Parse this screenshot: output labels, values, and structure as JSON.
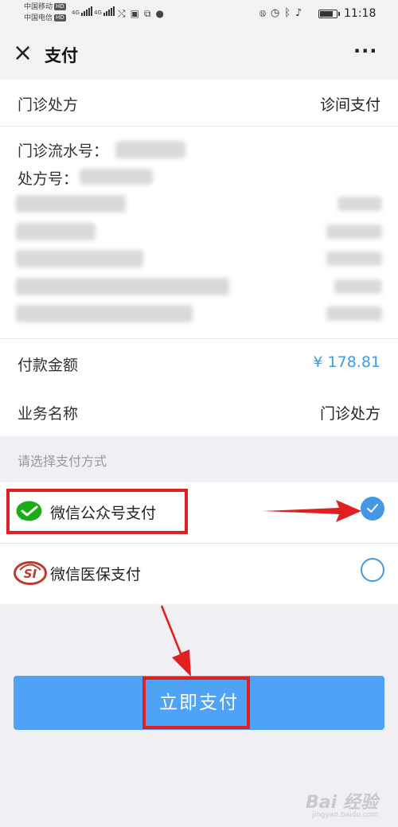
{
  "status_bar": {
    "carrier_1": "中国移动",
    "carrier_2": "中国电信",
    "hd_badge": "HD",
    "net_type": "4G",
    "time": "11:18",
    "battery_level": 0.85
  },
  "nav": {
    "close_glyph": "×",
    "title": "支付",
    "more_glyph": "···"
  },
  "prescription": {
    "label": "门诊处方",
    "value": "诊间支付"
  },
  "details": {
    "serial_label": "门诊流水号：",
    "rx_label": "处方号："
  },
  "amount": {
    "label": "付款金额",
    "value": "¥ 178.81"
  },
  "business": {
    "label": "业务名称",
    "value": "门诊处方"
  },
  "method_section": {
    "hint": "请选择支付方式"
  },
  "methods": [
    {
      "name": "微信公众号支付",
      "icon": "wechat-icon",
      "selected": true
    },
    {
      "name": "微信医保支付",
      "icon": "si-icon",
      "selected": false
    }
  ],
  "pay_button": {
    "label": "立即支付"
  },
  "watermark": {
    "brand": "Bai 经验",
    "url": "jingyan.baidu.com"
  },
  "colors": {
    "accent_blue": "#4fa3f7",
    "amount_blue": "#3e9be8",
    "annotation_red": "#e02020",
    "wechat_green": "#1aad19"
  }
}
